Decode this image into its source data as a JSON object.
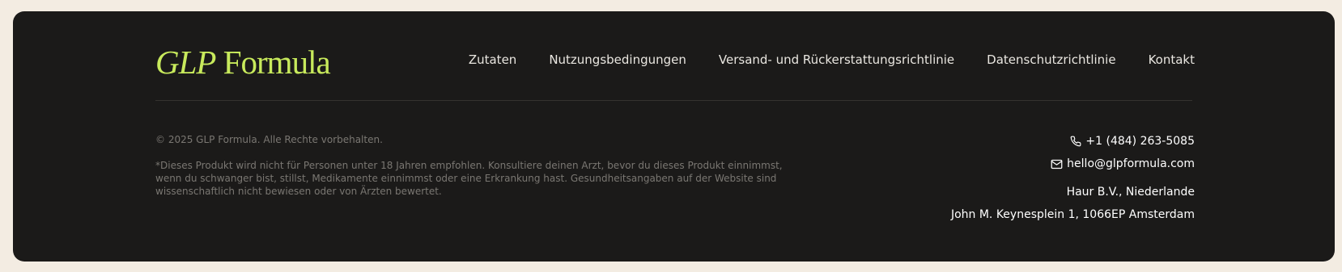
{
  "brand": {
    "logo_italic": "GLP",
    "logo_regular": " Formula",
    "logo_color": "#c8ea5c"
  },
  "nav": {
    "items": [
      {
        "label": "Zutaten"
      },
      {
        "label": "Nutzungsbedingungen"
      },
      {
        "label": "Versand- und Rückerstattungsrichtlinie"
      },
      {
        "label": "Datenschutzrichtlinie"
      },
      {
        "label": "Kontakt"
      }
    ]
  },
  "legal": {
    "copyright": "© 2025 GLP Formula. Alle Rechte vorbehalten.",
    "disclaimer": "*Dieses Produkt wird nicht für Personen unter 18 Jahren empfohlen. Konsultiere deinen Arzt, bevor du dieses Produkt einnimmst, wenn du schwanger bist, stillst, Medikamente einnimmst oder eine Erkrankung hast. Gesundheitsangaben auf der Website sind wissenschaftlich nicht bewiesen oder von Ärzten bewertet."
  },
  "contact": {
    "phone": "+1 (484) 263-5085",
    "phone_icon": "phone-icon",
    "email": "hello@glpformula.com",
    "email_icon": "mail-icon",
    "company": "Haur B.V., Niederlande",
    "address": "John M. Keynesplein 1, 1066EP Amsterdam"
  },
  "colors": {
    "page_background": "#f3ece2",
    "footer_background": "#1b1a19",
    "accent": "#c8ea5c",
    "muted_text": "#7a7772"
  }
}
